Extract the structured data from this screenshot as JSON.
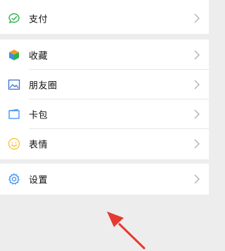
{
  "menu": {
    "pay": {
      "label": "支付",
      "icon": "pay-check-icon"
    },
    "favorites": {
      "label": "收藏",
      "icon": "cube-icon"
    },
    "moments": {
      "label": "朋友圈",
      "icon": "picture-icon"
    },
    "cards": {
      "label": "卡包",
      "icon": "card-icon"
    },
    "stickers": {
      "label": "表情",
      "icon": "smiley-icon"
    },
    "settings": {
      "label": "设置",
      "icon": "gear-icon"
    }
  },
  "colors": {
    "background": "#ededed",
    "row": "#ffffff",
    "pay_green": "#2ab248",
    "favorites_orange": "#f59a23",
    "favorites_blue": "#3c8ef0",
    "moments_blue": "#3c71c8",
    "cards_blue": "#3c8ef0",
    "stickers_yellow": "#f7c32e",
    "settings_blue": "#3c8ef0",
    "chevron": "#b2b2b2",
    "annotation_arrow": "#e53a2f"
  }
}
